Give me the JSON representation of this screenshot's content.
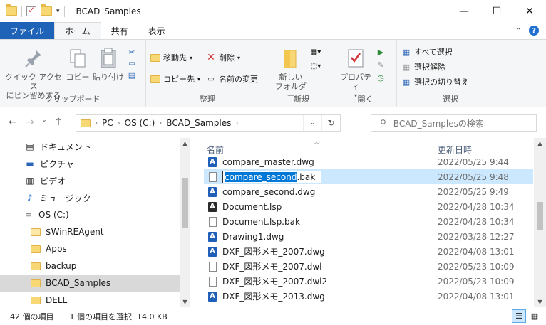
{
  "window": {
    "title": "BCAD_Samples"
  },
  "tabs": {
    "file": "ファイル",
    "home": "ホーム",
    "share": "共有",
    "view": "表示"
  },
  "ribbon": {
    "clipboard": {
      "label": "クリップボード",
      "pin": "クイック アクセス\nにピン留めする",
      "copy": "コピー",
      "paste": "貼り付け"
    },
    "organize": {
      "label": "整理",
      "move": "移動先",
      "copyto": "コピー先",
      "delete": "削除",
      "rename": "名前の変更"
    },
    "new": {
      "label": "新規",
      "newfolder": "新しい\nフォルダー"
    },
    "open": {
      "label": "開く",
      "properties": "プロパティ"
    },
    "select": {
      "label": "選択",
      "all": "すべて選択",
      "none": "選択解除",
      "invert": "選択の切り替え"
    }
  },
  "address": {
    "pc": "PC",
    "drive": "OS (C:)",
    "folder": "BCAD_Samples"
  },
  "search": {
    "placeholder": "BCAD_Samplesの検索"
  },
  "nav": {
    "items": [
      {
        "label": "ドキュメント",
        "icon": "documents-icon"
      },
      {
        "label": "ピクチャ",
        "icon": "pictures-icon"
      },
      {
        "label": "ビデオ",
        "icon": "videos-icon"
      },
      {
        "label": "ミュージック",
        "icon": "music-icon"
      },
      {
        "label": "OS (C:)",
        "icon": "drive-icon"
      },
      {
        "label": "$WinREAgent",
        "icon": "folder-icon"
      },
      {
        "label": "Apps",
        "icon": "folder-icon"
      },
      {
        "label": "backup",
        "icon": "folder-icon"
      },
      {
        "label": "BCAD_Samples",
        "icon": "folder-icon"
      },
      {
        "label": "DELL",
        "icon": "folder-icon"
      }
    ]
  },
  "columns": {
    "name": "名前",
    "date": "更新日時"
  },
  "files": [
    {
      "name": "compare_master.dwg",
      "date": "2022/05/25 9:44",
      "type": "dwg"
    },
    {
      "name_sel": "compare_second",
      "name_rest": ".bak",
      "date": "2022/05/25 9:48",
      "type": "blank"
    },
    {
      "name": "compare_second.dwg",
      "date": "2022/05/25 9:49",
      "type": "dwg"
    },
    {
      "name": "Document.lsp",
      "date": "2022/04/28 10:34",
      "type": "lsp"
    },
    {
      "name": "Document.lsp.bak",
      "date": "2022/04/28 10:34",
      "type": "blank"
    },
    {
      "name": "Drawing1.dwg",
      "date": "2022/03/28 12:27",
      "type": "dwg"
    },
    {
      "name": "DXF_図形メモ_2007.dwg",
      "date": "2022/04/08 13:01",
      "type": "dwg"
    },
    {
      "name": "DXF_図形メモ_2007.dwl",
      "date": "2022/05/23 10:09",
      "type": "blank"
    },
    {
      "name": "DXF_図形メモ_2007.dwl2",
      "date": "2022/05/23 10:09",
      "type": "blank"
    },
    {
      "name": "DXF_図形メモ_2013.dwg",
      "date": "2022/04/08 13:01",
      "type": "dwg"
    }
  ],
  "status": {
    "count": "42 個の項目",
    "selection": "1 個の項目を選択  14.0 KB"
  }
}
